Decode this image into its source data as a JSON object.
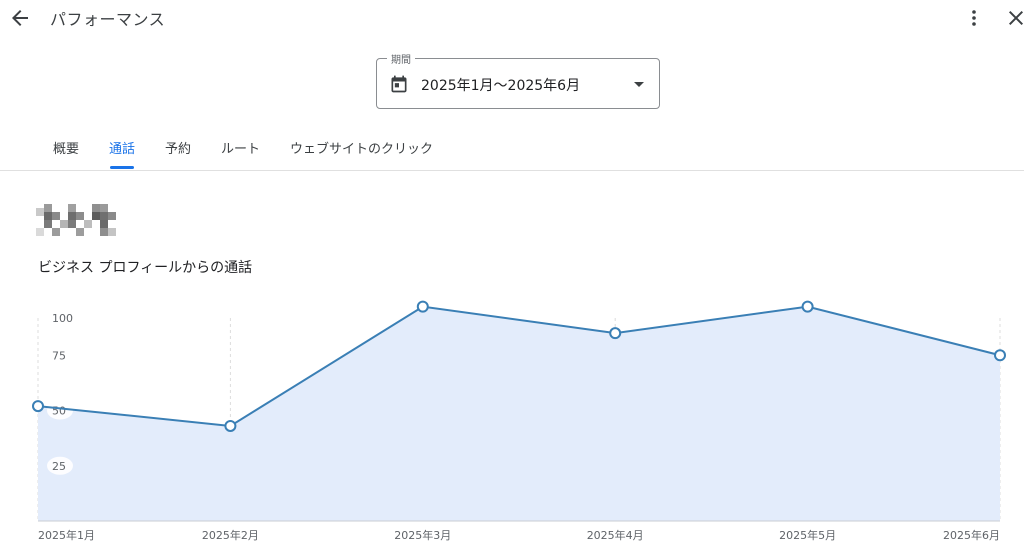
{
  "header": {
    "title": "パフォーマンス",
    "back_icon": "arrow-back-icon",
    "menu_icon": "more-vert-icon",
    "close_icon": "close-icon"
  },
  "period_selector": {
    "label": "期間",
    "value": "2025年1月〜2025年6月",
    "icon": "calendar-icon"
  },
  "tabs": [
    {
      "label": "概要",
      "active": false
    },
    {
      "label": "通話",
      "active": true
    },
    {
      "label": "予約",
      "active": false
    },
    {
      "label": "ルート",
      "active": false
    },
    {
      "label": "ウェブサイトのクリック",
      "active": false
    }
  ],
  "metric": {
    "label": "ビジネス プロフィールからの通話"
  },
  "colors": {
    "accent": "#1a73e8",
    "line": "#3a7fb5",
    "area": "#e3ecfb"
  },
  "chart_data": {
    "type": "area",
    "x": [
      "2025年1月",
      "2025年2月",
      "2025年3月",
      "2025年4月",
      "2025年5月",
      "2025年6月"
    ],
    "series": [
      {
        "values": [
          52,
          43,
          97,
          85,
          97,
          75
        ]
      }
    ],
    "yticks": [
      100,
      75,
      50,
      25
    ],
    "ylim": [
      0,
      100
    ],
    "grid": "vertical-dashed"
  }
}
